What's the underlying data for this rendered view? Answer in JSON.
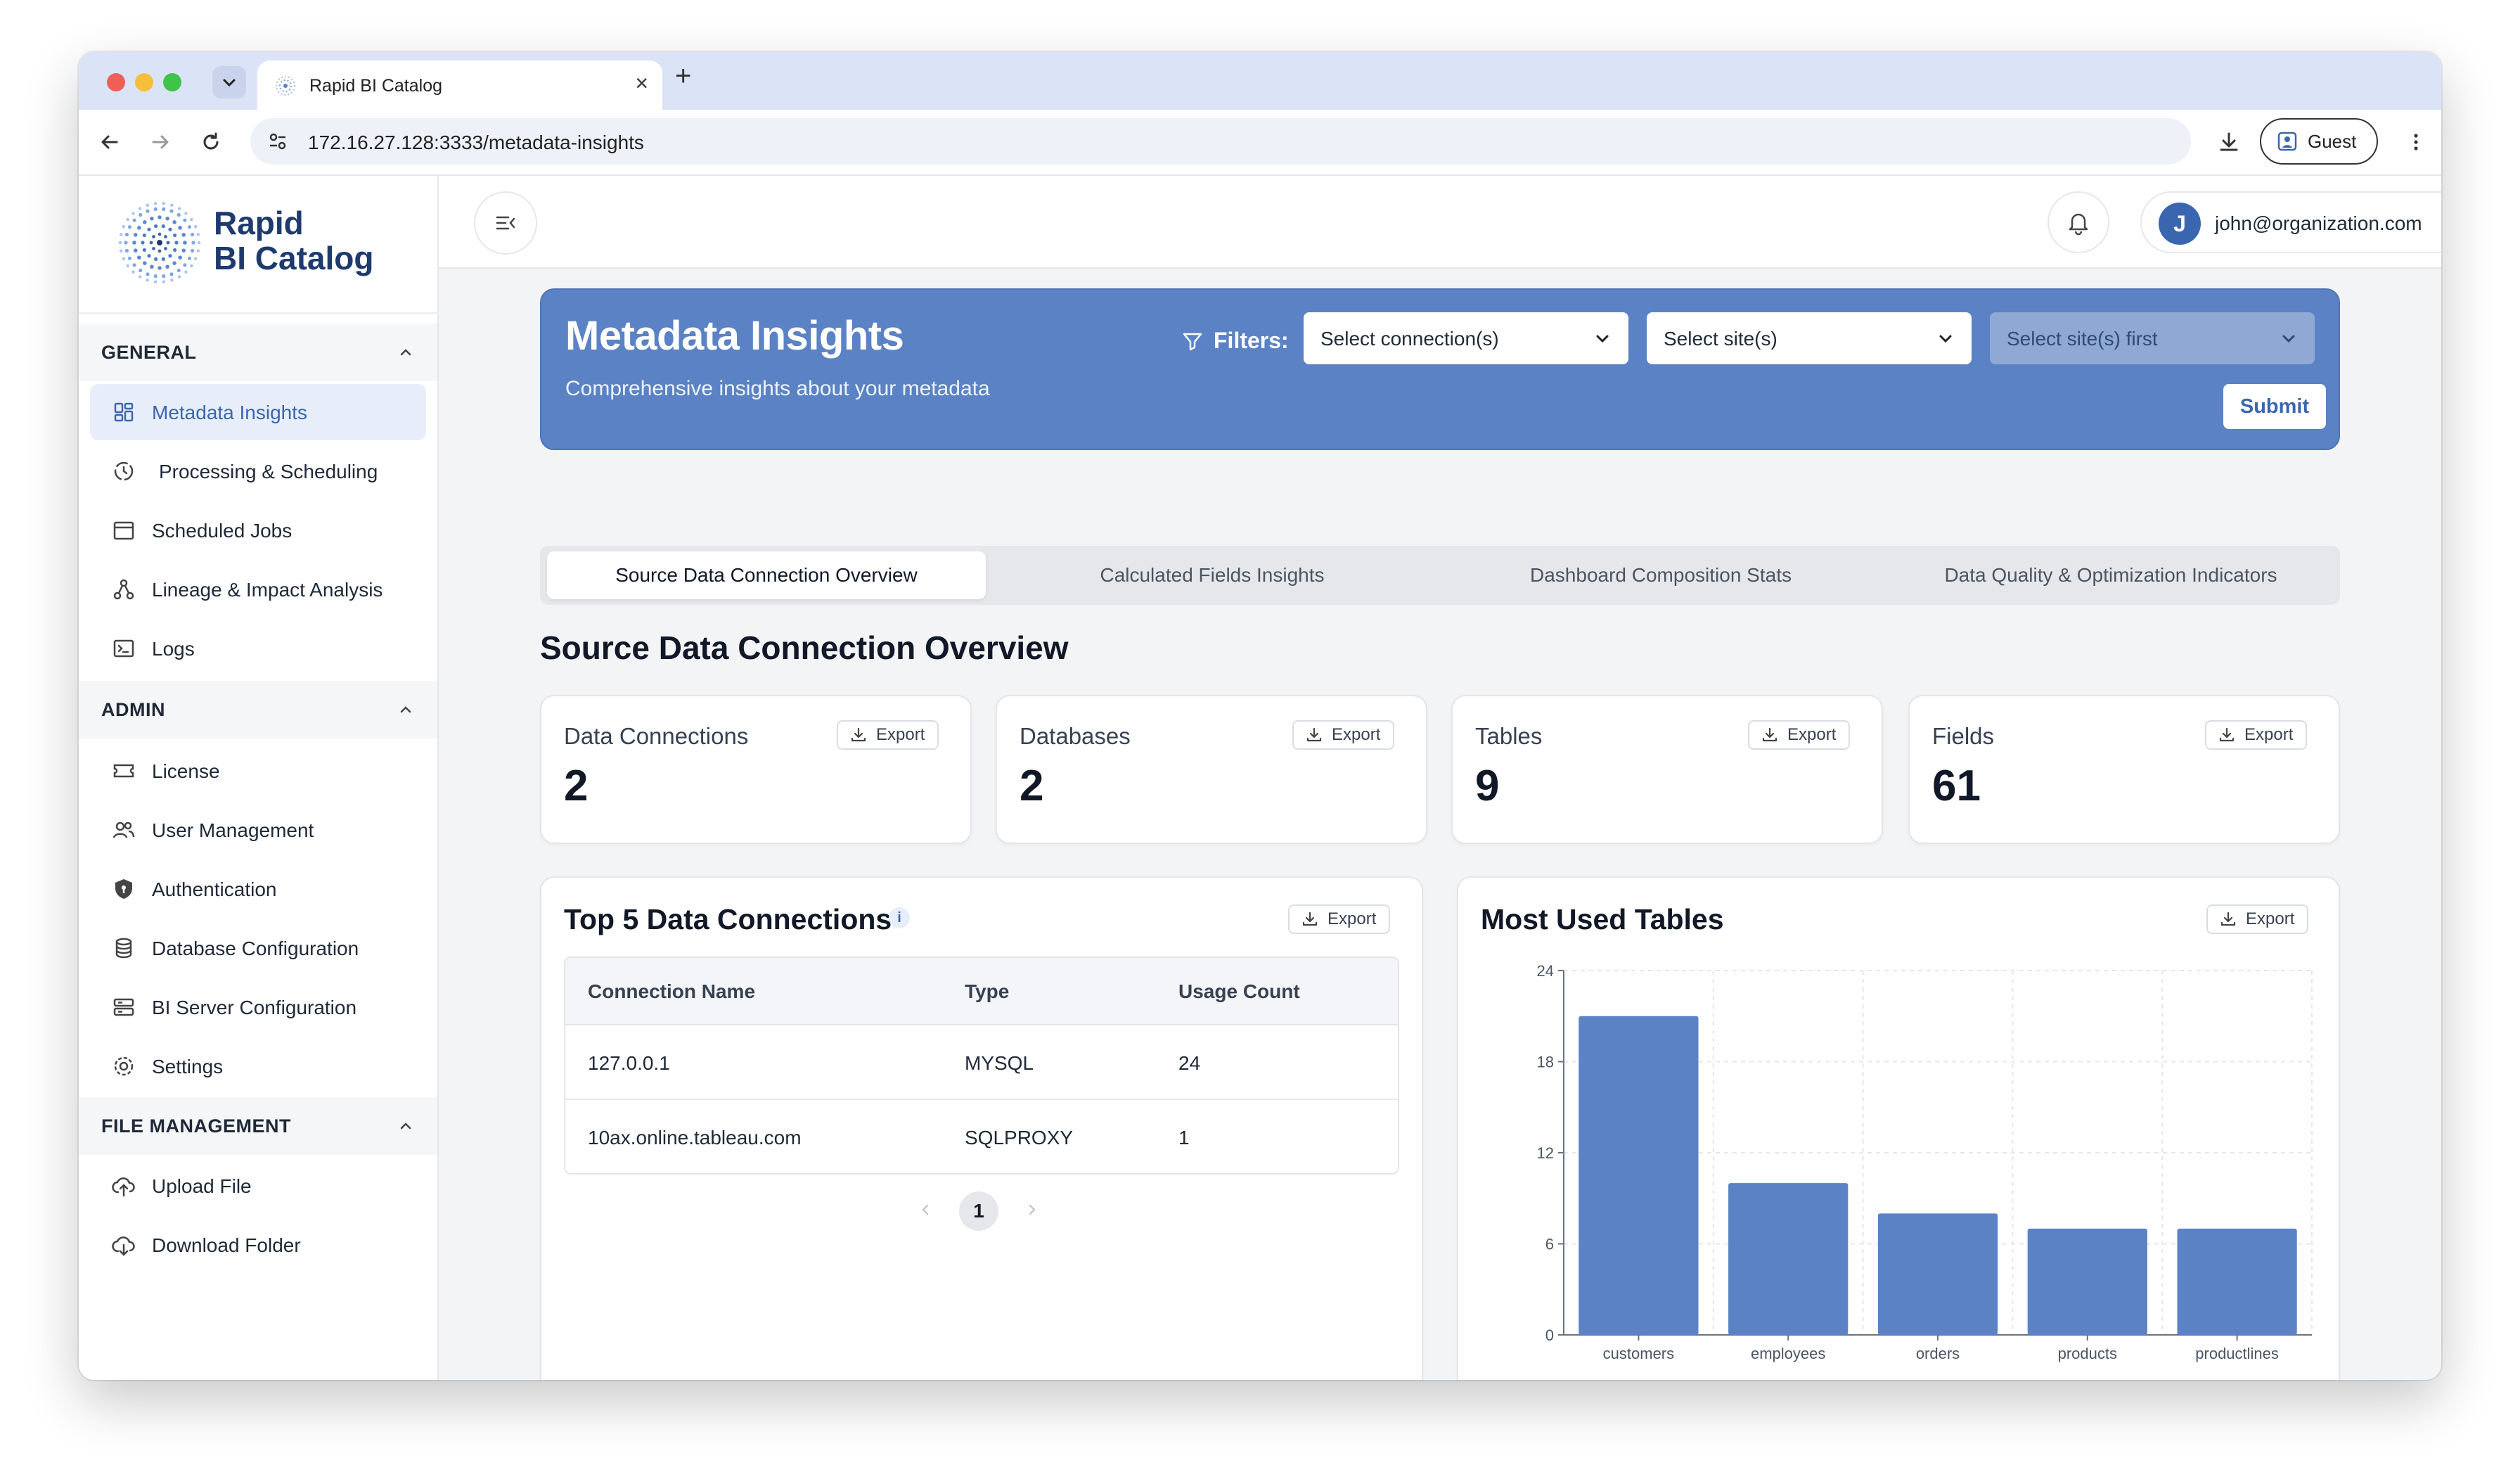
{
  "browser": {
    "tab_title": "Rapid BI Catalog",
    "url": "172.16.27.128:3333/metadata-insights",
    "profile_label": "Guest"
  },
  "sidebar": {
    "logo_line1": "Rapid",
    "logo_line2": "BI Catalog",
    "sections": [
      {
        "title": "GENERAL",
        "items": [
          {
            "label": "Metadata Insights",
            "icon": "dashboard-grid-icon",
            "active": true
          },
          {
            "label": "Processing & Scheduling",
            "icon": "processing-icon"
          },
          {
            "label": "Scheduled Jobs",
            "icon": "calendar-icon"
          },
          {
            "label": "Lineage & Impact Analysis",
            "icon": "lineage-icon"
          },
          {
            "label": "Logs",
            "icon": "terminal-icon"
          }
        ]
      },
      {
        "title": "ADMIN",
        "items": [
          {
            "label": "License",
            "icon": "ticket-icon"
          },
          {
            "label": "User Management",
            "icon": "users-icon"
          },
          {
            "label": "Authentication",
            "icon": "shield-icon"
          },
          {
            "label": "Database Configuration",
            "icon": "database-icon"
          },
          {
            "label": "BI Server Configuration",
            "icon": "server-icon"
          },
          {
            "label": "Settings",
            "icon": "gear-icon"
          }
        ]
      },
      {
        "title": "FILE MANAGEMENT",
        "items": [
          {
            "label": "Upload File",
            "icon": "cloud-upload-icon"
          },
          {
            "label": "Download Folder",
            "icon": "cloud-download-icon"
          }
        ]
      }
    ]
  },
  "header": {
    "user_initial": "J",
    "user_email": "john@organization.com"
  },
  "banner": {
    "title": "Metadata Insights",
    "subtitle": "Comprehensive insights about your metadata",
    "filters_label": "Filters:",
    "connection_select": "Select connection(s)",
    "site_select": "Select site(s)",
    "project_select": "Select site(s) first",
    "submit_label": "Submit"
  },
  "tabs": [
    {
      "label": "Source Data Connection Overview",
      "active": true
    },
    {
      "label": "Calculated Fields Insights"
    },
    {
      "label": "Dashboard Composition Stats"
    },
    {
      "label": "Data Quality & Optimization Indicators"
    }
  ],
  "section_title": "Source Data Connection Overview",
  "export_label": "Export",
  "stats": [
    {
      "label": "Data Connections",
      "value": "2"
    },
    {
      "label": "Databases",
      "value": "2"
    },
    {
      "label": "Tables",
      "value": "9"
    },
    {
      "label": "Fields",
      "value": "61"
    }
  ],
  "top_connections": {
    "title": "Top 5 Data Connections",
    "info": "i",
    "columns": [
      "Connection Name",
      "Type",
      "Usage Count"
    ],
    "rows": [
      [
        "127.0.0.1",
        "MYSQL",
        "24"
      ],
      [
        "10ax.online.tableau.com",
        "SQLPROXY",
        "1"
      ]
    ],
    "page": "1"
  },
  "chart_data": {
    "type": "bar",
    "title": "Most Used Tables",
    "categories": [
      "customers",
      "employees",
      "orders",
      "products",
      "productlines"
    ],
    "values": [
      21,
      10,
      8,
      7,
      7
    ],
    "ylim": [
      0,
      24
    ],
    "yticks": [
      "0",
      "6",
      "12",
      "18",
      "24"
    ],
    "grid": true,
    "bar_color": "#5a82c4"
  },
  "colors": {
    "accent": "#3a66b0",
    "banner": "#5a82c4"
  }
}
